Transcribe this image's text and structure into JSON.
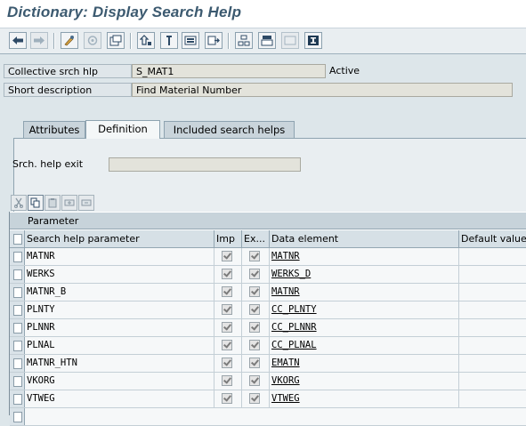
{
  "window": {
    "title": "Dictionary: Display Search Help"
  },
  "toolbar": {
    "buttons": [
      {
        "name": "back-arrow-icon"
      },
      {
        "name": "forward-arrow-icon"
      },
      {
        "name": "display-change-icon"
      },
      {
        "name": "other-object-icon"
      },
      {
        "name": "check-icon"
      },
      {
        "name": "where-used-icon"
      },
      {
        "name": "activate-icon"
      },
      {
        "name": "display-object-list-icon"
      },
      {
        "name": "navigate-icon"
      },
      {
        "name": "hierarchy-icon"
      },
      {
        "name": "test-icon"
      },
      {
        "name": "layout-icon"
      },
      {
        "name": "info-icon"
      }
    ]
  },
  "header": {
    "collective_label": "Collective srch hlp",
    "collective_value": "S_MAT1",
    "status": "Active",
    "short_desc_label": "Short description",
    "short_desc_value": "Find Material Number"
  },
  "tabs": [
    {
      "label": "Attributes",
      "active": false
    },
    {
      "label": "Definition",
      "active": true
    },
    {
      "label": "Included search helps",
      "active": false
    }
  ],
  "definition": {
    "exit_label": "Srch. help exit",
    "exit_value": ""
  },
  "grid": {
    "caption": "Parameter",
    "columns": [
      "Search help parameter",
      "Imp",
      "Ex...",
      "Data element",
      "Default value"
    ],
    "rows": [
      {
        "param": "MATNR",
        "imp": true,
        "exp": true,
        "element": "MATNR"
      },
      {
        "param": "WERKS",
        "imp": true,
        "exp": true,
        "element": "WERKS_D"
      },
      {
        "param": "MATNR_B",
        "imp": true,
        "exp": true,
        "element": "MATNR"
      },
      {
        "param": "PLNTY",
        "imp": true,
        "exp": true,
        "element": "CC_PLNTY"
      },
      {
        "param": "PLNNR",
        "imp": true,
        "exp": true,
        "element": "CC_PLNNR"
      },
      {
        "param": "PLNAL",
        "imp": true,
        "exp": true,
        "element": "CC_PLNAL"
      },
      {
        "param": "MATNR_HTN",
        "imp": true,
        "exp": true,
        "element": "EMATN"
      },
      {
        "param": "VKORG",
        "imp": true,
        "exp": true,
        "element": "VKORG"
      },
      {
        "param": "VTWEG",
        "imp": true,
        "exp": true,
        "element": "VTWEG"
      }
    ]
  }
}
